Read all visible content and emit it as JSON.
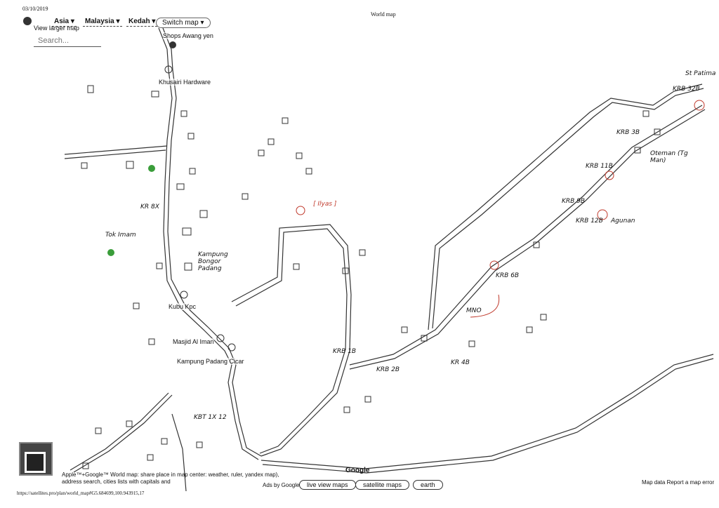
{
  "header": {
    "print_date": "03/10/2019",
    "page_title": "World map"
  },
  "toolbar": {
    "continent": "Asia",
    "country": "Malaysia",
    "state": "Kedah",
    "switch_label": "Switch map",
    "view_larger": "View larger map",
    "search_placeholder": "Search..."
  },
  "places": {
    "shops": "Shops Awang yen",
    "hardware": "Khusairi Hardware",
    "kubu": "Kubu Kpc",
    "masjid": "Masjid Al Iman",
    "kampung": "Kampung Padang Cicar"
  },
  "annotations": {
    "ilyas": "[ Ilyas ]",
    "kampung_bongor": "Kampung Bongor Padang",
    "kr_8x": "KR 8X",
    "tok_imam": "Tok Imam",
    "krb_1b": "KRB 1B",
    "krb_2b": "KRB 2B",
    "kbt": "KBT 1X 12",
    "kr_4b": "KR 4B",
    "krb_6b": "KRB 6B",
    "mno": "MNO",
    "krb_12b": "KRB 12B",
    "agunan": "Agunan",
    "krb_9b": "KRB 9B",
    "krb_11b": "KRB 11B",
    "krb_32b": "KRB 32B",
    "st_patima": "St Patima",
    "krb_3b": "KRB 3B",
    "oteman": "Oteman (Tg Man)"
  },
  "footer": {
    "attribution": "Apple™+Google™ World map: share place in map center: weather, ruler, yandex map), address search, cities lists with capitals and",
    "google": "Google",
    "ads": "Ads by Google",
    "live_view": "live view maps",
    "satellite": "satellite maps",
    "earth": "earth",
    "map_report": "Map data  Report a map error",
    "url": "https://satellites.pro/plan/world_map#G5.684699,100.943915,17"
  },
  "colors": {
    "road": "#333333",
    "annotation_red": "#c0392b",
    "marker_green": "#3a9d3a"
  }
}
